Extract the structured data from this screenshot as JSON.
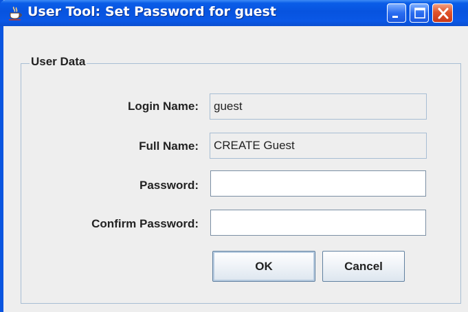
{
  "window": {
    "title": "User Tool: Set Password for guest",
    "app_icon": "java-cup-icon",
    "controls": {
      "minimize": "minimize-icon",
      "maximize": "maximize-icon",
      "close": "close-icon"
    }
  },
  "group": {
    "title": "User Data"
  },
  "form": {
    "login_name_label": "Login Name:",
    "login_name_value": "guest",
    "full_name_label": "Full Name:",
    "full_name_value": "CREATE Guest",
    "password_label": "Password:",
    "password_value": "",
    "confirm_password_label": "Confirm Password:",
    "confirm_password_value": ""
  },
  "buttons": {
    "ok_label": "OK",
    "cancel_label": "Cancel"
  },
  "colors": {
    "titlebar": "#0a55e0",
    "close_button": "#e0542a",
    "group_border": "#a7bdd3"
  }
}
